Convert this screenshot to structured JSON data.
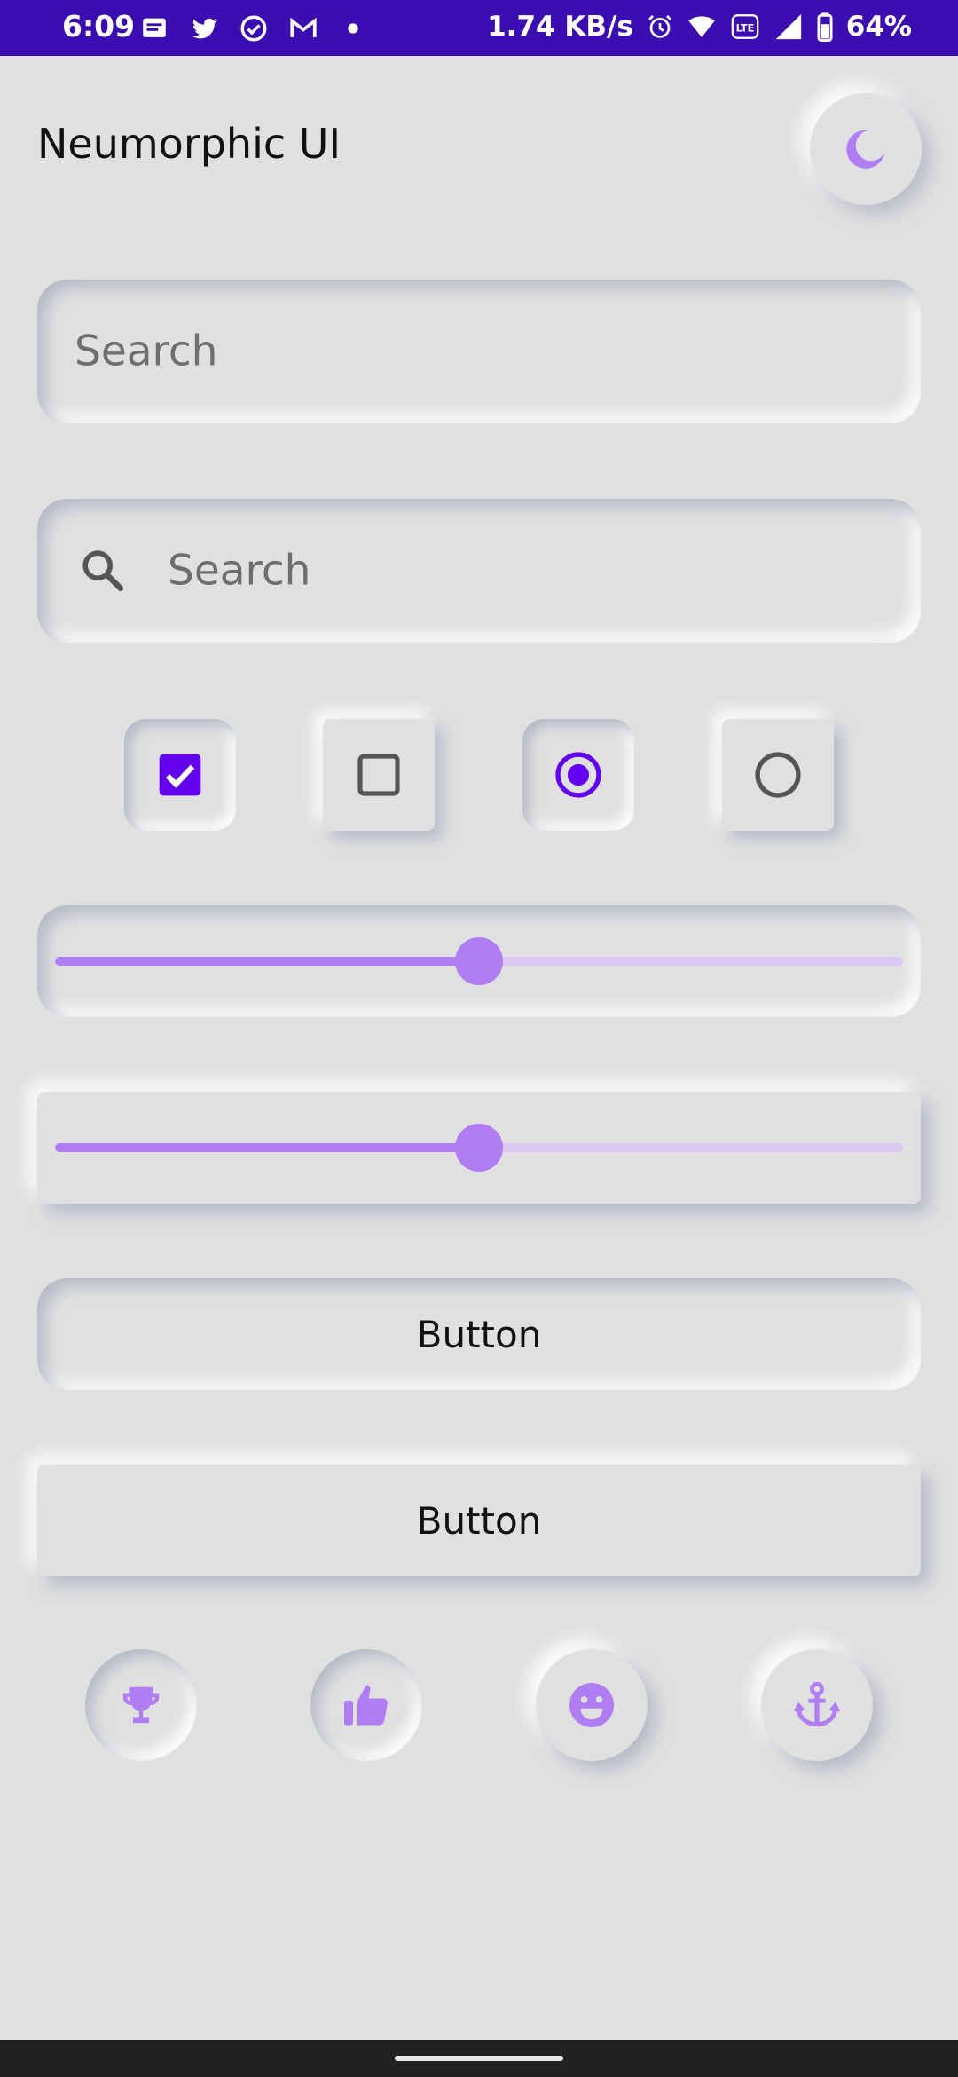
{
  "status_bar": {
    "time": "6:09",
    "network_speed": "1.74 KB/s",
    "battery": "64%",
    "left_icons": [
      "message-icon",
      "twitter-icon",
      "check-circle-icon",
      "gmail-icon",
      "dot-icon"
    ],
    "right_icons": [
      "alarm-icon",
      "wifi-icon",
      "volte-icon",
      "signal-icon",
      "battery-icon"
    ]
  },
  "header": {
    "title": "Neumorphic UI",
    "theme_toggle_icon": "moon-icon"
  },
  "search_fields": [
    {
      "placeholder": "Search",
      "icon": null
    },
    {
      "placeholder": "Search",
      "icon": "search-icon"
    }
  ],
  "toggles": [
    {
      "type": "checkbox",
      "checked": true
    },
    {
      "type": "checkbox",
      "checked": false
    },
    {
      "type": "radio",
      "checked": true
    },
    {
      "type": "radio",
      "checked": false
    }
  ],
  "sliders": [
    {
      "style": "inset",
      "value": 0.5
    },
    {
      "style": "raised",
      "value": 0.5
    }
  ],
  "buttons": [
    {
      "label": "Button",
      "style": "inset"
    },
    {
      "label": "Button",
      "style": "raised"
    }
  ],
  "icon_buttons": [
    {
      "icon": "trophy-icon",
      "style": "inset"
    },
    {
      "icon": "thumbs-up-icon",
      "style": "inset"
    },
    {
      "icon": "smiley-icon",
      "style": "raised"
    },
    {
      "icon": "anchor-icon",
      "style": "raised"
    }
  ],
  "colors": {
    "accent": "#b07ef2",
    "primary": "#6200ee",
    "status_bar": "#3b0db0",
    "background": "#e0e0e0"
  }
}
